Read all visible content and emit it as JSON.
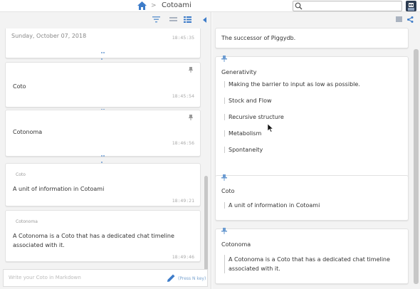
{
  "header": {
    "title": "Cotoami",
    "separator": ">",
    "search": {
      "value": "",
      "placeholder": ""
    }
  },
  "timeline": {
    "date_header": "Sunday, October 07, 2018",
    "posts": [
      {
        "text": "",
        "timestamp": "18:45:35"
      },
      {
        "text": "Coto",
        "timestamp": "18:45:54"
      },
      {
        "text": "Cotonoma",
        "timestamp": "18:46:56"
      },
      {
        "source": "Coto",
        "text": "A unit of information in Cotoami",
        "timestamp": "18:49:21"
      },
      {
        "source": "Cotonoma",
        "text": "A Cotonoma is a Coto that has a dedicated chat timeline associated with it.",
        "timestamp": "18:49:46"
      }
    ],
    "input": {
      "placeholder": "Write your Coto in Markdown",
      "hint": "(Press N key)"
    }
  },
  "pinned": {
    "cards": [
      {
        "title": "The successor of Piggydb.",
        "items": []
      },
      {
        "title": "Generativity",
        "items": [
          "Making the barrier to input as low as possible.",
          "Stock and Flow",
          "Recursive structure",
          "Metabolism",
          "Spontaneity"
        ]
      },
      {
        "title": "Coto",
        "items": [
          "A unit of information in Cotoami"
        ]
      },
      {
        "title": "Cotonoma",
        "items": [
          "A Cotonoma is a Coto that has a dedicated chat timeline associated with it."
        ]
      }
    ]
  },
  "colors": {
    "accent": "#3d7cc9",
    "dots": "#6b9bd1",
    "panel_bg": "#f3f3f3"
  },
  "icons": [
    "home-icon",
    "search-icon",
    "filter-icon",
    "list-view-icon",
    "grid-view-icon",
    "collapse-left-icon",
    "pin-icon",
    "share-icon",
    "pencil-icon",
    "more-dots-icon"
  ]
}
